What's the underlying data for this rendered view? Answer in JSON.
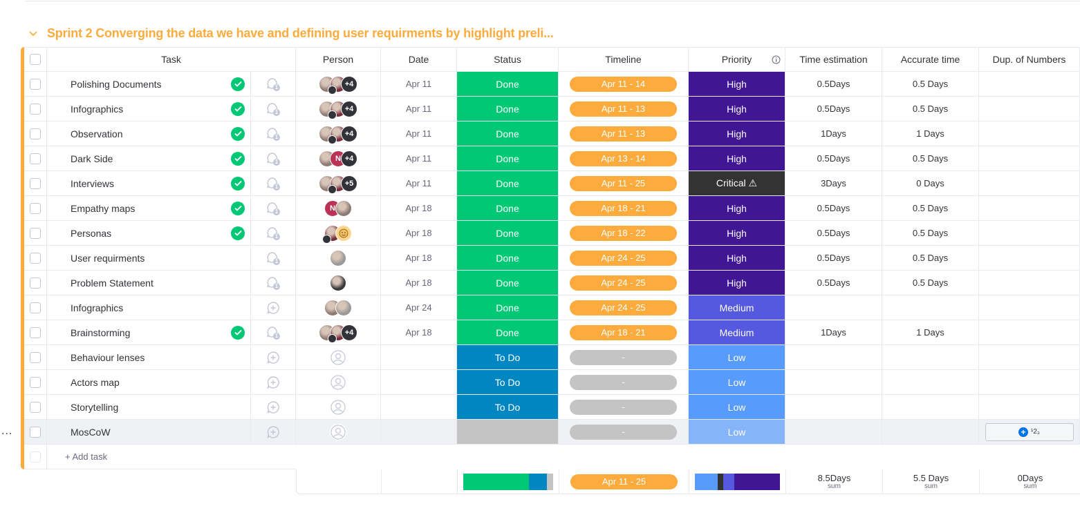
{
  "group": {
    "title": "Sprint 2 Converging the data we have and defining user requirments by highlight preli...",
    "color": "#fdab3d"
  },
  "columns": {
    "task": "Task",
    "person": "Person",
    "date": "Date",
    "status": "Status",
    "timeline": "Timeline",
    "priority": "Priority",
    "time_estimation": "Time estimation",
    "accurate_time": "Accurate time",
    "dup_numbers": "Dup. of Numbers"
  },
  "colors": {
    "done": "#00c875",
    "todo": "#0086c0",
    "empty": "#c4c4c4",
    "timeline": "#fdab3d",
    "high": "#401694",
    "critical": "#333333",
    "medium": "#5559df",
    "low": "#579bfc"
  },
  "rows": [
    {
      "task": "Polishing Documents",
      "done": true,
      "updates": "1",
      "people": [
        "photo-a",
        "photo-b"
      ],
      "more": "+4",
      "date": "Apr 11",
      "status": "Done",
      "timeline": "Apr 11 - 14",
      "priority": "High",
      "est": "0.5Days",
      "acc": "0.5 Days"
    },
    {
      "task": "Infographics",
      "done": true,
      "updates": "1",
      "people": [
        "photo-a",
        "photo-b"
      ],
      "more": "+4",
      "date": "Apr 11",
      "status": "Done",
      "timeline": "Apr 11 - 13",
      "priority": "High",
      "est": "0.5Days",
      "acc": "0.5 Days"
    },
    {
      "task": "Observation",
      "done": true,
      "updates": "1",
      "people": [
        "photo-a",
        "photo-b"
      ],
      "more": "+4",
      "date": "Apr 11",
      "status": "Done",
      "timeline": "Apr 11 - 13",
      "priority": "High",
      "est": "1Days",
      "acc": "1 Days"
    },
    {
      "task": "Dark Side",
      "done": true,
      "updates": "1",
      "people": [
        "photo-a",
        "initial-N"
      ],
      "more": "+4",
      "date": "Apr 11",
      "status": "Done",
      "timeline": "Apr 13 - 14",
      "priority": "High",
      "est": "0.5Days",
      "acc": "0.5 Days"
    },
    {
      "task": "Interviews",
      "done": true,
      "updates": "1",
      "people": [
        "photo-a",
        "photo-b"
      ],
      "more": "+5",
      "date": "Apr 11",
      "status": "Done",
      "timeline": "Apr 11 - 25",
      "priority": "Critical ⚠",
      "est": "3Days",
      "acc": "0 Days"
    },
    {
      "task": "Empathy maps",
      "done": true,
      "updates": "1",
      "people": [
        "initial-N",
        "photo-a"
      ],
      "more": "",
      "date": "Apr 18",
      "status": "Done",
      "timeline": "Apr 18 - 21",
      "priority": "High",
      "est": "0.5Days",
      "acc": "0.5 Days"
    },
    {
      "task": "Personas",
      "done": true,
      "updates": "1",
      "people": [
        "photo-b",
        "emoji"
      ],
      "more": "",
      "date": "Apr 18",
      "status": "Done",
      "timeline": "Apr 18 - 22",
      "priority": "High",
      "est": "0.5Days",
      "acc": "0.5 Days"
    },
    {
      "task": "User requirments",
      "done": false,
      "updates": "1",
      "people": [
        "photo-c"
      ],
      "more": "",
      "date": "Apr 18",
      "status": "Done",
      "timeline": "Apr 24 - 25",
      "priority": "High",
      "est": "0.5Days",
      "acc": "0.5 Days"
    },
    {
      "task": "Problem Statement",
      "done": false,
      "updates": "1",
      "people": [
        "photo-d"
      ],
      "more": "",
      "date": "Apr 18",
      "status": "Done",
      "timeline": "Apr 24 - 25",
      "priority": "High",
      "est": "0.5Days",
      "acc": "0.5 Days"
    },
    {
      "task": "Infographics",
      "done": false,
      "updates": "",
      "people": [
        "photo-a",
        "photo-c"
      ],
      "more": "",
      "date": "Apr 24",
      "status": "Done",
      "timeline": "Apr 24 - 25",
      "priority": "Medium",
      "est": "",
      "acc": ""
    },
    {
      "task": "Brainstorming",
      "done": true,
      "updates": "1",
      "people": [
        "photo-a",
        "photo-b"
      ],
      "more": "+4",
      "date": "Apr 18",
      "status": "Done",
      "timeline": "Apr 18 - 21",
      "priority": "Medium",
      "est": "1Days",
      "acc": "1 Days"
    },
    {
      "task": "Behaviour lenses",
      "done": false,
      "updates": "",
      "people": [],
      "more": "",
      "date": "",
      "status": "To Do",
      "timeline": "-",
      "priority": "Low",
      "est": "",
      "acc": ""
    },
    {
      "task": "Actors map",
      "done": false,
      "updates": "",
      "people": [],
      "more": "",
      "date": "",
      "status": "To Do",
      "timeline": "-",
      "priority": "Low",
      "est": "",
      "acc": ""
    },
    {
      "task": "Storytelling",
      "done": false,
      "updates": "",
      "people": [],
      "more": "",
      "date": "",
      "status": "To Do",
      "timeline": "-",
      "priority": "Low",
      "est": "",
      "acc": ""
    },
    {
      "task": "MosCoW",
      "done": false,
      "updates": "",
      "people": [],
      "more": "",
      "date": "",
      "status": "",
      "timeline": "-",
      "priority": "Low",
      "est": "",
      "acc": ""
    }
  ],
  "add_task": "+ Add task",
  "row_menu": "...",
  "dup_button_label": "¹2₃",
  "summary": {
    "timeline": "Apr 11 - 25",
    "est_value": "8.5Days",
    "acc_value": "5.5 Days",
    "dup_value": "0Days",
    "sum_label": "sum",
    "status_distribution": {
      "Done": 11,
      "To Do": 3,
      "Empty": 1
    },
    "priority_distribution": {
      "Low": 4,
      "Critical": 1,
      "Medium": 2,
      "High": 8
    }
  }
}
